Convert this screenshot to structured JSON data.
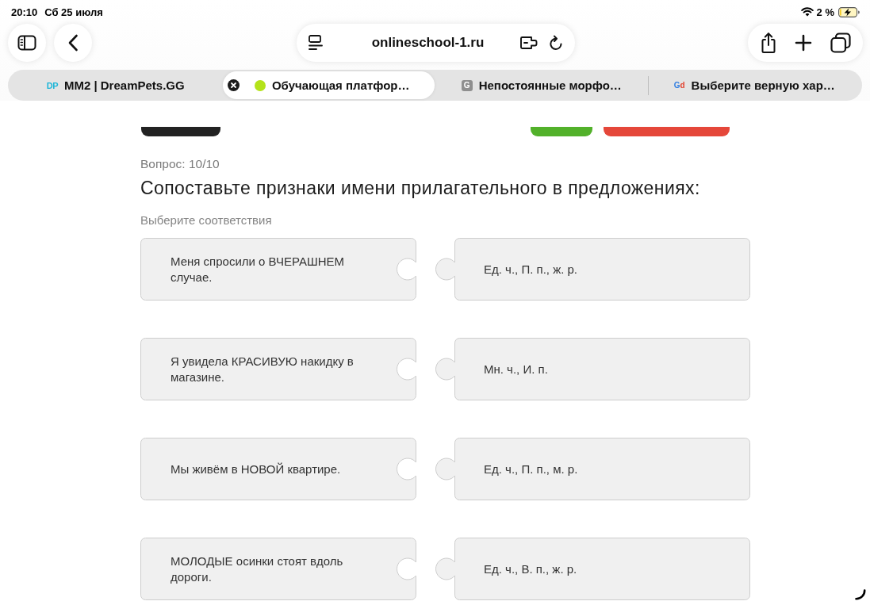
{
  "status_bar": {
    "time": "20:10",
    "date": "Сб 25 июля",
    "battery": "2 %"
  },
  "toolbar": {
    "address": "onlineschool-1.ru"
  },
  "tabs": [
    {
      "title": "MM2 | DreamPets.GG",
      "selected": false,
      "favicon": {
        "kind": "text",
        "text": "DP",
        "color": "#1fb6d8"
      }
    },
    {
      "title": "Обучающая платфор…",
      "selected": true,
      "favicon": {
        "kind": "dot",
        "color": "#b4e31a"
      }
    },
    {
      "title": "Непостоянные морфо…",
      "selected": false,
      "favicon": {
        "kind": "tile",
        "text": "G"
      }
    },
    {
      "title": "Выберите верную хар…",
      "selected": false,
      "favicon": {
        "kind": "letters",
        "text": "Gd"
      }
    }
  ],
  "quiz": {
    "top_buttons": [
      {
        "color": "#222222"
      },
      {
        "color": "#52b12a"
      },
      {
        "color": "#e5473a"
      }
    ],
    "counter": "Вопрос: 10/10",
    "question": "Сопоставьте признаки имени прилагательного в предложениях:",
    "hint": "Выберите соответствия",
    "pairs": [
      {
        "left": "Меня спросили о ВЧЕРАШНЕМ случае.",
        "right": "Ед. ч., П. п., ж. р."
      },
      {
        "left": "Я увидела КРАСИВУЮ накидку в магазине.",
        "right": "Мн. ч., И. п."
      },
      {
        "left": "Мы живём в НОВОЙ квартире.",
        "right": "Ед. ч., П. п., м. р."
      },
      {
        "left": "МОЛОДЫЕ осинки стоят вдоль дороги.",
        "right": "Ед. ч., В. п., ж. р."
      }
    ]
  }
}
